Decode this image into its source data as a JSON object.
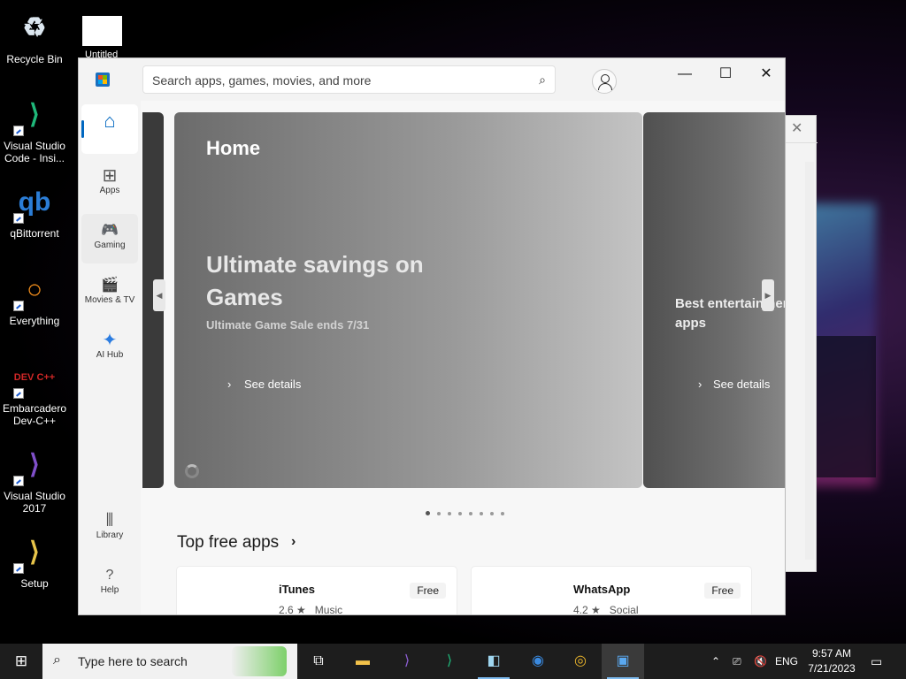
{
  "desktop": {
    "icons": [
      {
        "label": "Recycle Bin",
        "glyph": "♻",
        "color": "#dce7f0"
      },
      {
        "label": "Visual Studio Code - Insi...",
        "glyph": "⟩",
        "color": "#1fb87a"
      },
      {
        "label": "qBittorrent",
        "glyph": "qb",
        "color": "#2b7dd6"
      },
      {
        "label": "Everything",
        "glyph": "○",
        "color": "#f28c1c"
      },
      {
        "label": "Embarcadero Dev-C++",
        "glyph": "DEV C++",
        "color": "#d02727"
      },
      {
        "label": "Visual Studio 2017",
        "glyph": "⟩",
        "color": "#7f4fc9"
      },
      {
        "label": "Setup",
        "glyph": "⟩",
        "color": "#e7c44a"
      }
    ],
    "untitled_label": "Untitled"
  },
  "store": {
    "search_placeholder": "Search apps, games, movies, and more",
    "window_controls": {
      "minimize": "—",
      "maximize": "☐",
      "close": "✕"
    },
    "nav": [
      {
        "label": "",
        "icon": "home-icon",
        "glyph": "⌂"
      },
      {
        "label": "Apps",
        "icon": "apps-icon",
        "glyph": "⊞"
      },
      {
        "label": "Gaming",
        "icon": "gaming-icon",
        "glyph": "🎮"
      },
      {
        "label": "Movies & TV",
        "icon": "movies-icon",
        "glyph": "🎬"
      },
      {
        "label": "AI Hub",
        "icon": "ai-hub-icon",
        "glyph": "✦"
      },
      {
        "label": "Library",
        "icon": "library-icon",
        "glyph": "⫴"
      },
      {
        "label": "Help",
        "icon": "help-icon",
        "glyph": "?"
      }
    ],
    "hero": {
      "page_title": "Home",
      "headline": "Ultimate savings on Games",
      "subtitle": "Ultimate Game Sale ends 7/31",
      "cta": "See details"
    },
    "next_hero": {
      "title": "Best entertainment apps",
      "cta": "See details"
    },
    "carousel_dots": 8,
    "carousel_active": 0,
    "section_title": "Top free apps",
    "cards": [
      {
        "name": "iTunes",
        "rating": "2.6 ★",
        "category": "Music",
        "price": "Free"
      },
      {
        "name": "WhatsApp",
        "rating": "4.2 ★",
        "category": "Social",
        "price": "Free"
      }
    ]
  },
  "taskbar": {
    "search_text": "Type here to search",
    "language": "ENG",
    "time": "9:57 AM",
    "date": "7/21/2023"
  }
}
